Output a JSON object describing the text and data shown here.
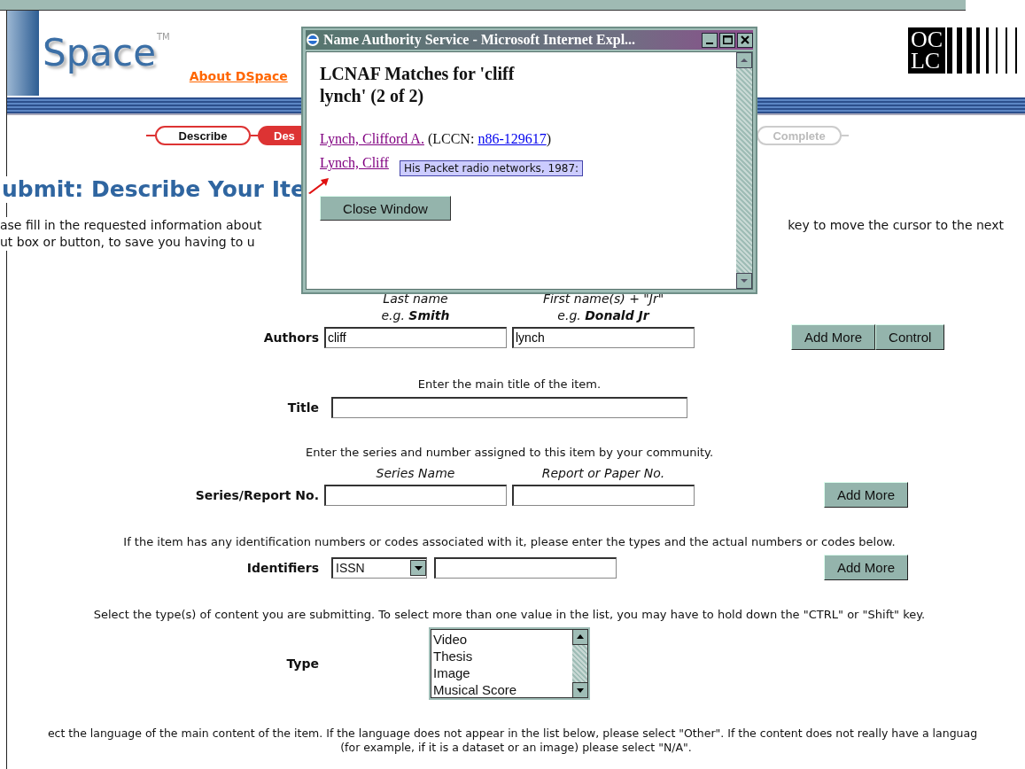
{
  "header": {
    "logo_text": "Space",
    "trademark": "TM",
    "about_link": "About DSpace",
    "partner_logo": {
      "line_1": "OC",
      "line_2": "LC"
    }
  },
  "progress_steps": [
    {
      "label": "Describe",
      "done": true,
      "current": false
    },
    {
      "label": "Des",
      "done": false,
      "current": true
    },
    {
      "label": "Complete",
      "done": false,
      "current": false
    }
  ],
  "page_title": "ubmit: Describe Your Ite",
  "intro": [
    {
      "left": "ase fill in the requested information about",
      "right": "key to move the cursor to the next"
    },
    {
      "left": "ut box or button, to save you having to u"
    }
  ],
  "form": [
    {
      "hints": [
        {
          "line_1": "Last name",
          "line_2": "e.g. **Smith**"
        },
        {
          "line_1": "First name(s) + \"Jr\"",
          "line_2": "e.g. **Donald Jr**"
        }
      ],
      "label": "Authors",
      "controls": [
        {
          "kind": "text",
          "value": "cliff"
        },
        {
          "kind": "text",
          "value": "lynch"
        }
      ],
      "buttons": [
        "Add More",
        "Control"
      ]
    },
    {
      "instruction": "Enter the main title of the item.",
      "label": "Title",
      "controls": [
        {
          "kind": "wide_text"
        }
      ]
    },
    {
      "instruction": "Enter the series and number assigned to this item by your community.",
      "hints": [
        {
          "line_1": "Series Name"
        },
        {
          "line_1": "Report or Paper No."
        }
      ],
      "label": "Series/Report No.",
      "controls": [
        {
          "kind": "text"
        },
        {
          "kind": "text"
        }
      ],
      "buttons": [
        "Add More"
      ]
    },
    {
      "instruction": "If the item has any identification numbers or codes associated with it, please enter the types and the actual numbers or codes below.",
      "label": "Identifiers",
      "controls": [
        {
          "kind": "select",
          "value": "ISSN"
        },
        {
          "kind": "text"
        }
      ],
      "buttons": [
        "Add More"
      ]
    },
    {
      "instruction": "Select the type(s) of content you are submitting. To select more than one value in the list, you may have to hold down the \"CTRL\" or \"Shift\" key.",
      "label": "Type",
      "controls": [
        {
          "kind": "listbox",
          "options": [
            {
              "label": "Video",
              "selected": false
            },
            {
              "label": "Thesis",
              "selected": false
            },
            {
              "label": "Image",
              "selected": false
            },
            {
              "label": "Musical Score",
              "selected": false
            }
          ]
        }
      ]
    }
  ],
  "language_note": [
    "ect the language of the main content of the item. If the language does not appear in the list below, please select \"Other\". If the content does not really have a languag",
    "(for example, if it is a dataset or an image) please select \"N/A\"."
  ],
  "popup": {
    "title": "Name Authority Service - Microsoft Internet Expl...",
    "heading": "LCNAF Matches for 'cliff lynch' (2 of 2)",
    "matches": [
      {
        "name": "Lynch, Clifford A.",
        "name_visited": true,
        "prefix": "(LCCN: ",
        "lccn": "n86-129617",
        "lccn_visited": false,
        "suffix": ")"
      },
      {
        "name": "Lynch, Cliff",
        "name_visited": true
      }
    ],
    "tooltip": "His Packet radio networks, 1987:",
    "button": "Close Window"
  }
}
